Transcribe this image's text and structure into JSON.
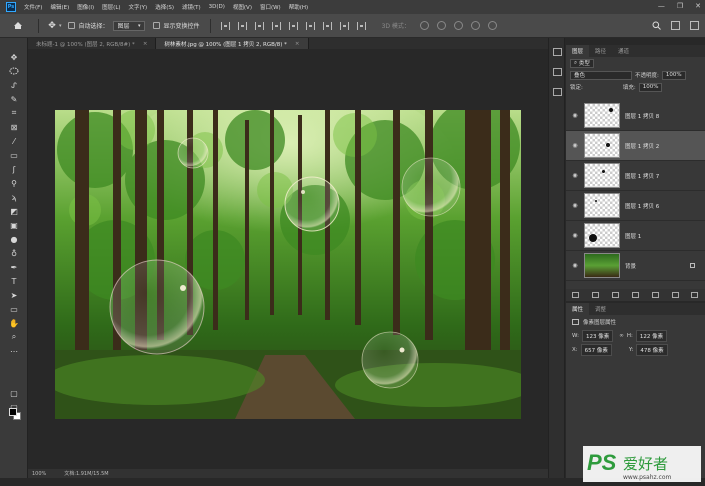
{
  "app": {
    "logo": "Ps"
  },
  "menu": [
    "文件(F)",
    "编辑(E)",
    "图像(I)",
    "图层(L)",
    "文字(Y)",
    "选择(S)",
    "滤镜(T)",
    "3D(D)",
    "视图(V)",
    "窗口(W)",
    "帮助(H)"
  ],
  "window_controls": [
    "—",
    "❐",
    "✕"
  ],
  "options": {
    "auto_select_label": "自动选择：",
    "auto_select_value": "图层",
    "transform_label": "显示变换控件",
    "mode3d_label": "3D 模式："
  },
  "tabs": [
    {
      "label": "未标题-1 @ 100% (图层 2, RGB/8#) *",
      "close": "×",
      "active": false
    },
    {
      "label": "树林素材.jpg @ 100% (图层 1 拷贝 2, RGB/8) *",
      "close": "×",
      "active": true
    }
  ],
  "status": {
    "zoom": "100%",
    "doc": "文档:1.91M/15.5M"
  },
  "layers_panel": {
    "tabs": [
      "图层",
      "路径",
      "通道"
    ],
    "filter_label": "类型",
    "blend_mode": "叠色",
    "opacity_label": "不透明度:",
    "opacity_value": "100%",
    "lock_label": "锁定:",
    "fill_label": "填充:",
    "fill_value": "100%",
    "layers": [
      {
        "name": "图层 1 拷贝 8",
        "selected": false
      },
      {
        "name": "图层 1 拷贝 2",
        "selected": true
      },
      {
        "name": "图层 1 拷贝 7",
        "selected": false
      },
      {
        "name": "图层 1 拷贝 6",
        "selected": false
      },
      {
        "name": "图层 1",
        "selected": false
      },
      {
        "name": "背景",
        "selected": false
      }
    ],
    "footer_icons": [
      "link-icon",
      "fx-icon",
      "mask-icon",
      "adjustment-icon",
      "group-icon",
      "new-layer-icon",
      "trash-icon"
    ]
  },
  "properties_panel": {
    "tabs": [
      "属性",
      "调整"
    ],
    "title": "像素图层属性",
    "w_label": "W:",
    "w_value": "123 像素",
    "h_label": "H:",
    "h_value": "122 像素",
    "x_label": "X:",
    "x_value": "657 像素",
    "y_label": "Y:",
    "y_value": "478 像素"
  },
  "watermark": {
    "brand": "PS",
    "text": "爱好者",
    "url": "www.psahz.com"
  }
}
